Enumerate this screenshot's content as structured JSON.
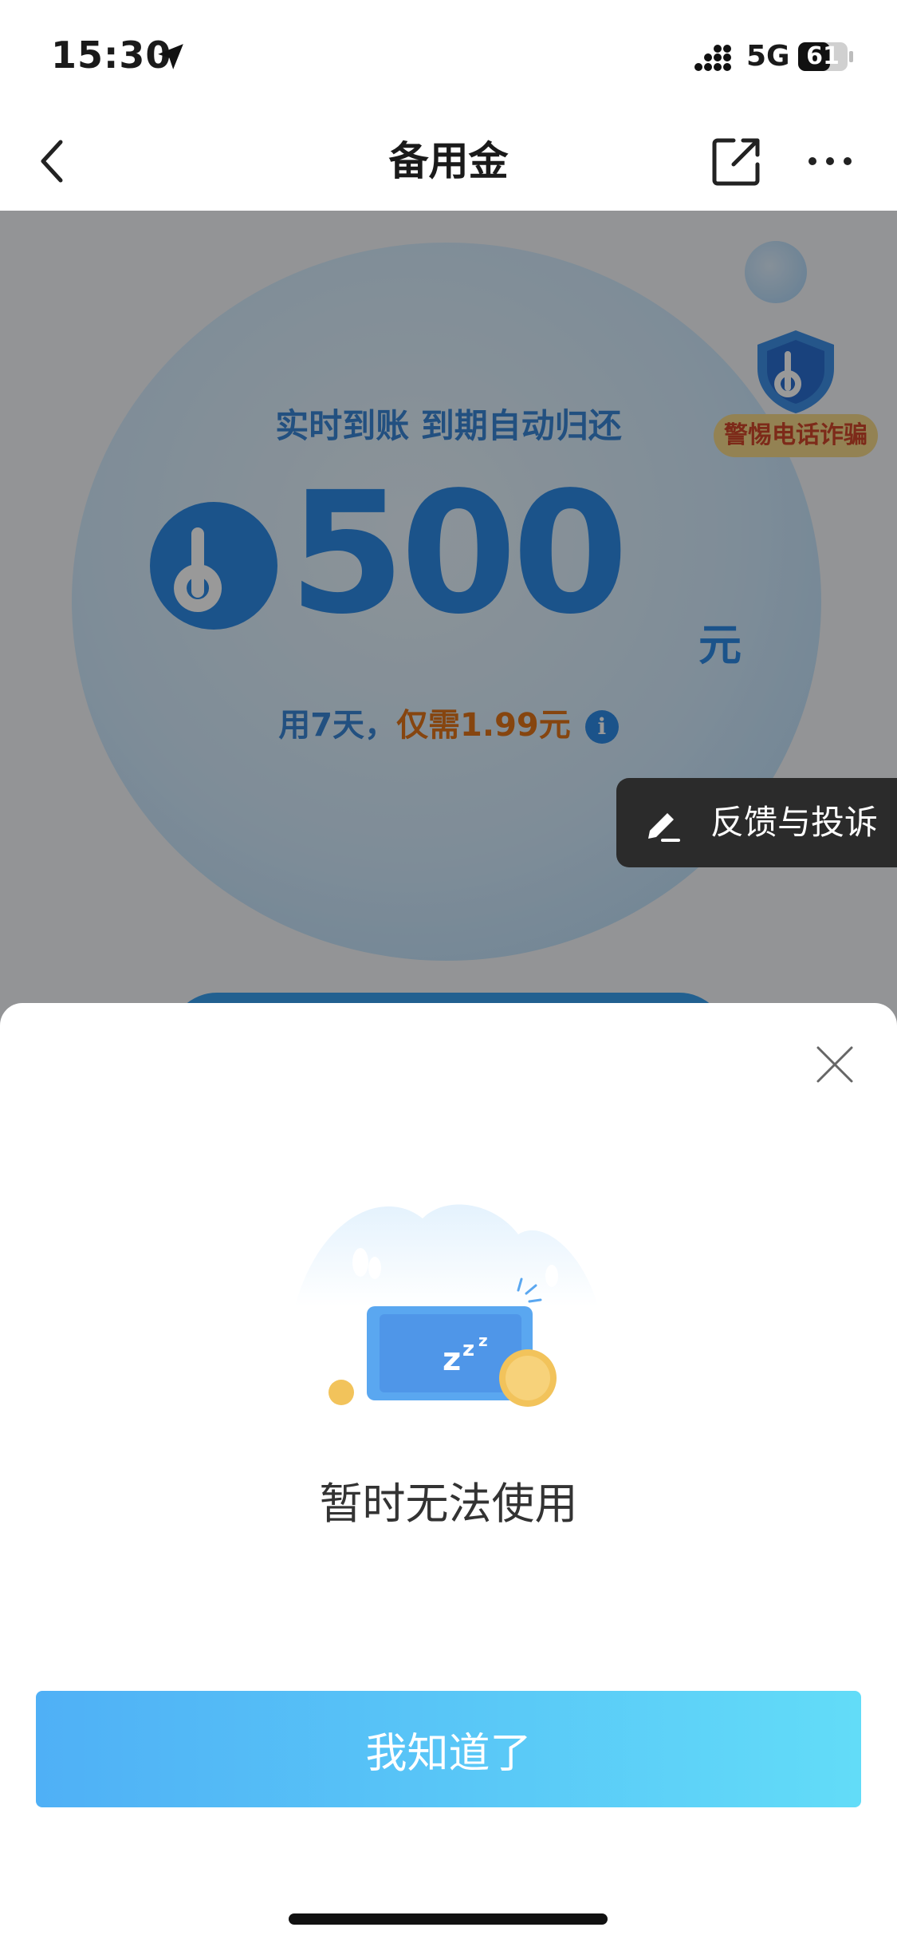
{
  "status_bar": {
    "time": "15:30",
    "network": "5G",
    "battery": "61"
  },
  "nav": {
    "title": "备用金"
  },
  "hero": {
    "tagline": "实时到账 到期自动归还",
    "amount": "500",
    "unit": "元",
    "fee_prefix": "用7天，",
    "fee_highlight": "仅需1.99元",
    "info_glyph": "i",
    "fraud_badge": "警惕电话诈骗"
  },
  "feedback": {
    "label": "反馈与投诉"
  },
  "dialog": {
    "message": "暂时无法使用",
    "button_label": "我知道了"
  },
  "colors": {
    "brand_blue": "#2e8be6",
    "button_gradient_start": "#4fb0f6",
    "button_gradient_end": "#62dcf8",
    "fee_orange": "#e0731a"
  },
  "icons": [
    "location-arrow-icon",
    "signal-icon",
    "battery-icon",
    "back-icon",
    "share-icon",
    "more-icon",
    "shield-logo-icon",
    "brand-b-icon",
    "info-icon",
    "edit-pen-icon",
    "close-icon"
  ]
}
